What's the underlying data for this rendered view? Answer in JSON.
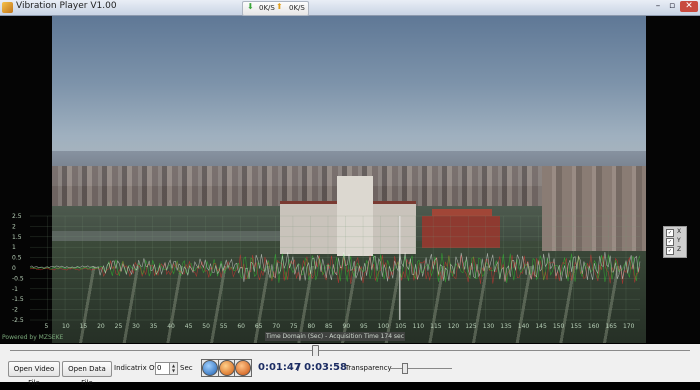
{
  "window": {
    "title": "Vibration Player V1.00",
    "close_glyph": "✕",
    "min_glyph": "–",
    "max_glyph": "▫"
  },
  "netmeter": {
    "down_value": "0K/S",
    "up_value": "0K/S",
    "down_color": "#3aa53a",
    "up_color": "#e0a020"
  },
  "graph": {
    "y_ticks": [
      "2.5",
      "2",
      "1.5",
      "1",
      "0.5",
      "0",
      "-0.5",
      "-1",
      "-1.5",
      "-2",
      "-2.5"
    ],
    "x_ticks": [
      "5",
      "10",
      "15",
      "20",
      "25",
      "30",
      "35",
      "40",
      "45",
      "50",
      "55",
      "60",
      "65",
      "70",
      "75",
      "80",
      "85",
      "90",
      "95",
      "100",
      "105",
      "110",
      "115",
      "120",
      "125",
      "130",
      "135",
      "140",
      "145",
      "150",
      "155",
      "160",
      "165",
      "170"
    ],
    "axis_title": "Time Domain (Sec) - Acquisition Time 174 sec",
    "powered_by": "Powered by MZSEKE",
    "cursor_time": 105.5
  },
  "axes_panel": [
    {
      "label": "X",
      "checked": true,
      "color": "#ff3030"
    },
    {
      "label": "Y",
      "checked": true,
      "color": "#30e030"
    },
    {
      "label": "Z",
      "checked": true,
      "color": "#ffffff"
    }
  ],
  "seek": {
    "progress": 0.46
  },
  "controls": {
    "open_video": "Open Video File",
    "open_data": "Open Data File",
    "offset_label": "Indicatrix Offset",
    "offset_value": "0",
    "offset_unit": "Sec",
    "current_time": "0:01:47",
    "total_time": "/ 0:03:58",
    "transparency_label": "Transparency",
    "transparency": 0.22
  }
}
